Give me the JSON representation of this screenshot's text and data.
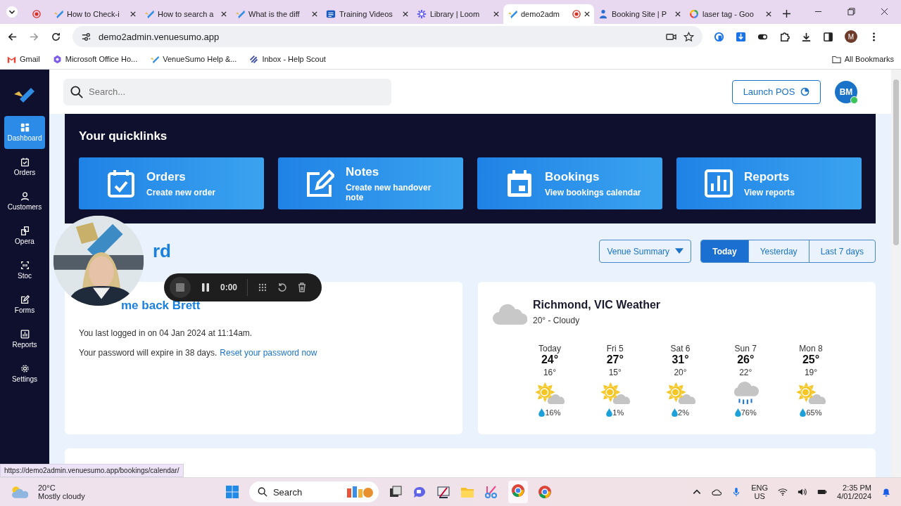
{
  "browser": {
    "tabs": [
      {
        "recording": true,
        "selected": false
      },
      {
        "title": "How to Check-i",
        "recording": false,
        "selected": false
      },
      {
        "title": "How to search a",
        "recording": false,
        "selected": false
      },
      {
        "title": "What is the diff",
        "recording": false,
        "selected": false
      },
      {
        "title": "Training Videos",
        "recording": false,
        "selected": false
      },
      {
        "title": "Library | Loom",
        "recording": false,
        "selected": false
      },
      {
        "title": "demo2adm",
        "recording": true,
        "selected": true
      },
      {
        "title": "Booking Site | P",
        "recording": false,
        "selected": false
      },
      {
        "title": "laser tag - Goo",
        "recording": false,
        "selected": false
      }
    ],
    "url": "demo2admin.venuesumo.app",
    "profile": "M",
    "bookmarks": [
      "Gmail",
      "Microsoft Office Ho...",
      "VenueSumo Help &...",
      "Inbox - Help Scout"
    ],
    "all_bookmarks": "All Bookmarks",
    "status_url": "https://demo2admin.venuesumo.app/bookings/calendar/"
  },
  "sidebar": {
    "items": [
      {
        "label": "Dashboard",
        "selected": true
      },
      {
        "label": "Orders",
        "selected": false
      },
      {
        "label": "Customers",
        "selected": false
      },
      {
        "label": "Opera",
        "selected": false
      },
      {
        "label": "Stoc",
        "selected": false
      },
      {
        "label": "Forms",
        "selected": false
      },
      {
        "label": "Reports",
        "selected": false
      },
      {
        "label": "Settings",
        "selected": false
      }
    ]
  },
  "header": {
    "search": {
      "placeholder": "Search..."
    },
    "launch_button": "Launch POS",
    "avatar": {
      "initials": "BM",
      "online": true
    }
  },
  "quicklinks": {
    "title": "Your quicklinks",
    "cards": [
      {
        "title": "Orders",
        "subtitle": "Create new order"
      },
      {
        "title": "Notes",
        "subtitle": "Create new handover note"
      },
      {
        "title": "Bookings",
        "subtitle": "View bookings calendar"
      },
      {
        "title": "Reports",
        "subtitle": "View reports"
      }
    ]
  },
  "dashboard": {
    "heading": "rd",
    "filter": "Venue Summary",
    "ranges": [
      {
        "label": "Today",
        "selected": true
      },
      {
        "label": "Yesterday",
        "selected": false
      },
      {
        "label": "Last 7 days",
        "selected": false
      }
    ]
  },
  "welcome": {
    "title": "me back Brett",
    "last_login": "You last logged in on 04 Jan 2024 at 11:14am.",
    "password_text": "Your password will expire in 38 days.",
    "reset_link": "Reset your password now"
  },
  "weather": {
    "title": "Richmond, VIC Weather",
    "current": "20° - Cloudy",
    "days": [
      {
        "name": "Today",
        "high": "24°",
        "low": "16°",
        "rain": "16%",
        "kind": "sun_cloud"
      },
      {
        "name": "Fri 5",
        "high": "27°",
        "low": "15°",
        "rain": "1%",
        "kind": "sun_cloud"
      },
      {
        "name": "Sat 6",
        "high": "31°",
        "low": "20°",
        "rain": "2%",
        "kind": "sun_cloud"
      },
      {
        "name": "Sun 7",
        "high": "26°",
        "low": "22°",
        "rain": "76%",
        "kind": "rain"
      },
      {
        "name": "Mon 8",
        "high": "25°",
        "low": "19°",
        "rain": "65%",
        "kind": "sun_cloud"
      }
    ]
  },
  "recorder": {
    "time": "0:00"
  },
  "taskbar": {
    "weather_temp": "20°C",
    "weather_text": "Mostly cloudy",
    "search": "Search",
    "language": "ENG",
    "region": "US",
    "time": "2:35 PM",
    "date": "4/01/2024"
  }
}
